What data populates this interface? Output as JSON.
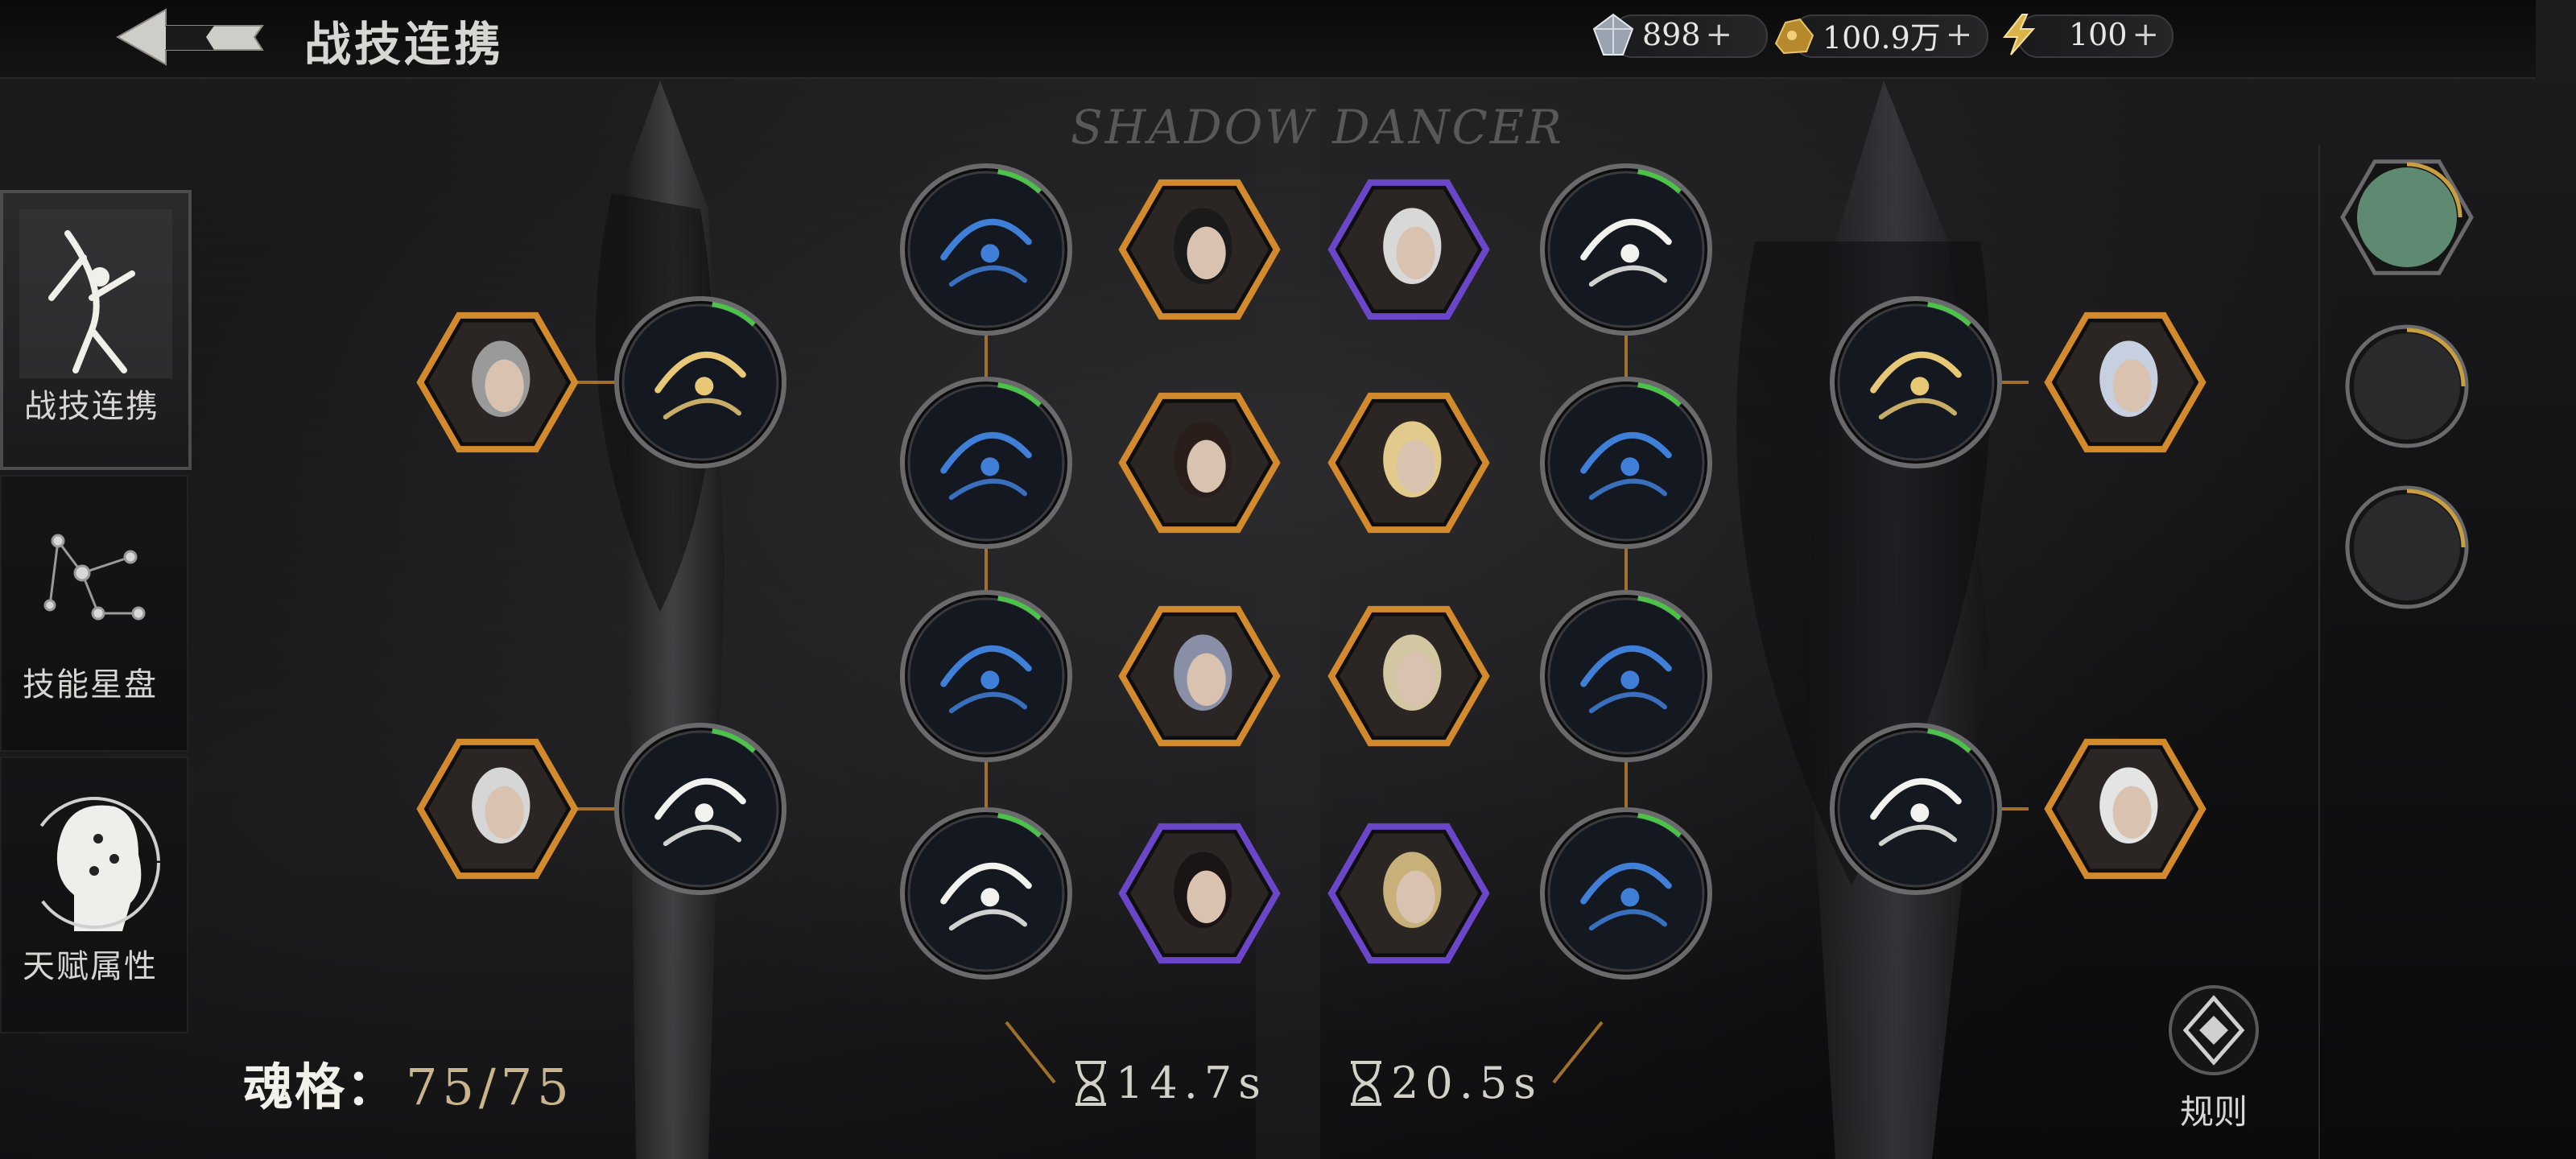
{
  "header": {
    "title": "战技连携",
    "resources": [
      {
        "icon": "crystal-icon",
        "value": "898",
        "plus": "+"
      },
      {
        "icon": "gold-ore-icon",
        "value": "100.9万",
        "plus": "+"
      },
      {
        "icon": "lightning-icon",
        "value": "100",
        "plus": "+"
      }
    ]
  },
  "subtitle": "SHADOW DANCER",
  "sidebar": {
    "items": [
      {
        "label": "战技连携",
        "active": true,
        "icon": "dancer-silhouette-icon"
      },
      {
        "label": "技能星盘",
        "active": false,
        "icon": "constellation-icon"
      },
      {
        "label": "天赋属性",
        "active": false,
        "icon": "head-profile-icon"
      }
    ]
  },
  "soul": {
    "label": "魂格：",
    "value": "75/75"
  },
  "timers": [
    {
      "value": "14.7s",
      "icon": "hourglass-icon"
    },
    {
      "value": "20.5s",
      "icon": "hourglass-icon"
    }
  ],
  "rules": {
    "label": "规则",
    "icon": "rules-icon"
  },
  "right_panel": {
    "icons": [
      "green-mask-icon",
      "blades-icon",
      "guardian-icon"
    ]
  },
  "colors": {
    "gold": "#d28a2c",
    "purple": "#6b46c8",
    "blue_skill": "#3f7fd8",
    "cooldown_green": "#4cc24a"
  }
}
